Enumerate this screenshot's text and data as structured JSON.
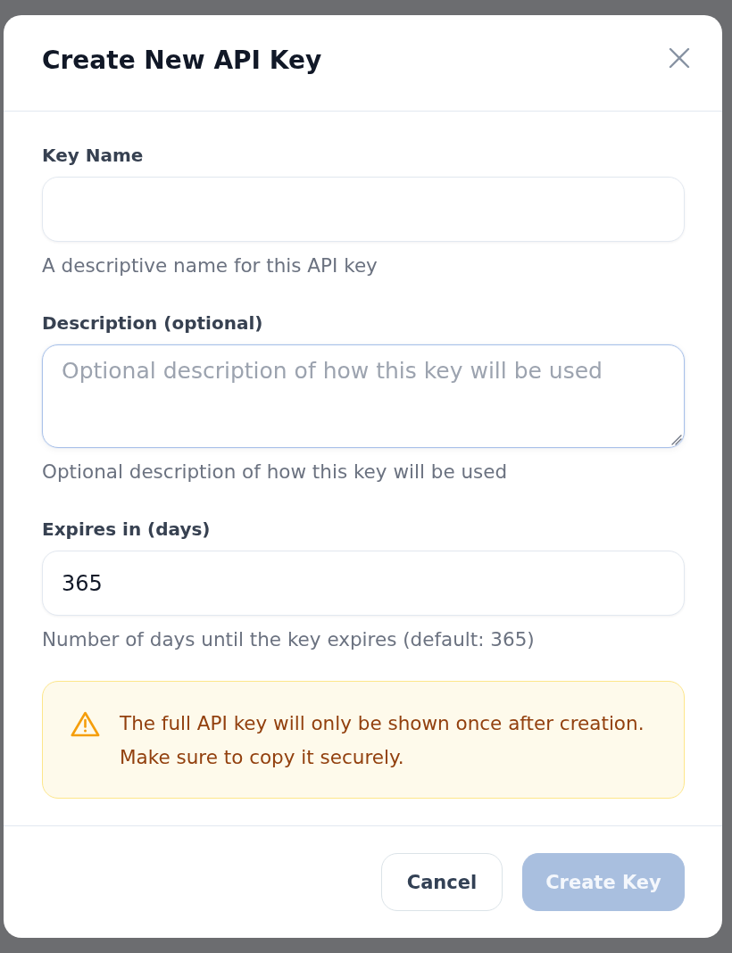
{
  "dialog": {
    "title": "Create New API Key"
  },
  "fields": [
    {
      "kind": "input",
      "label": "Key Name",
      "hint": "A descriptive name for this API key",
      "focused": false
    },
    {
      "kind": "textarea",
      "label": "Description (optional)",
      "placeholder": "Optional description of how this key will be used",
      "hint": "Optional description of how this key will be used",
      "focused": true
    },
    {
      "kind": "input",
      "label": "Expires in (days)",
      "value": "365",
      "hint": "Number of days until the key expires (default: 365)",
      "focused": false
    }
  ],
  "warning": {
    "text": "The full API key will only be shown once after creation.\nMake sure to copy it securely."
  },
  "buttons": [
    {
      "kind": "secondary",
      "label": "Cancel",
      "disabled": false
    },
    {
      "kind": "primary",
      "label": "Create Key",
      "disabled": true
    }
  ]
}
